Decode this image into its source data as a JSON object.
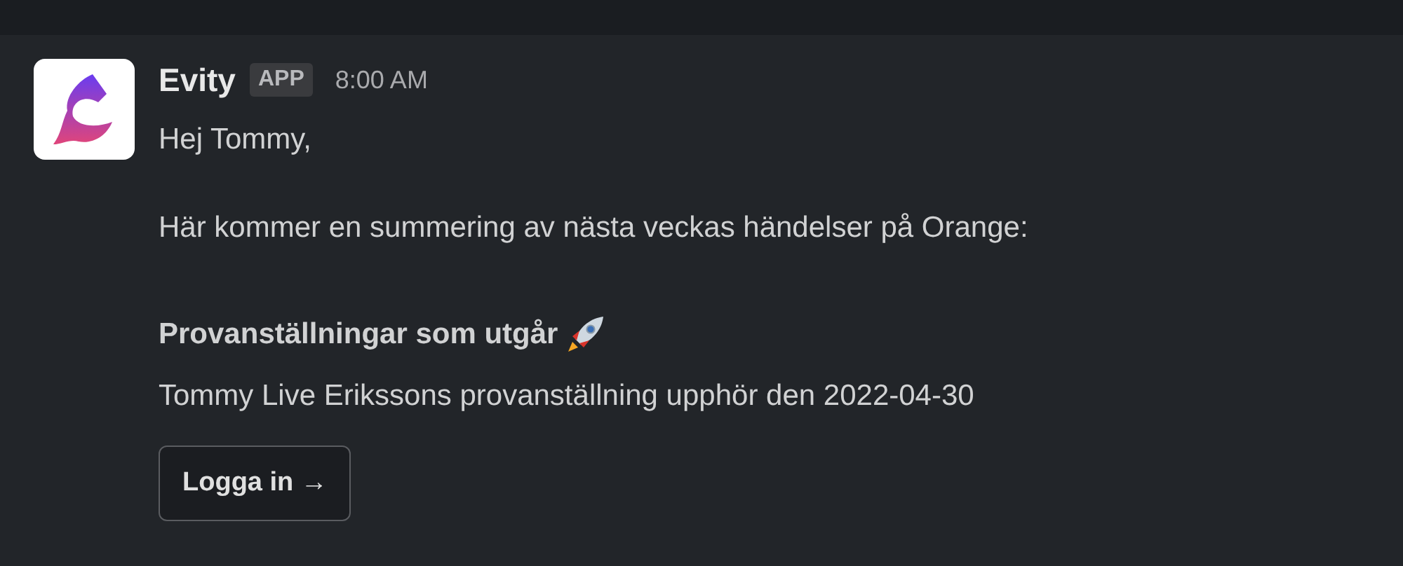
{
  "message": {
    "sender": "Evity",
    "badge": "APP",
    "time": "8:00 AM",
    "greeting": "Hej Tommy,",
    "intro": "Här kommer en summering av nästa veckas händelser på Orange:",
    "section_title": "Provanställningar som utgår",
    "section_text": "Tommy Live Erikssons provanställning upphör den 2022-04-30",
    "button": "Logga in →"
  }
}
